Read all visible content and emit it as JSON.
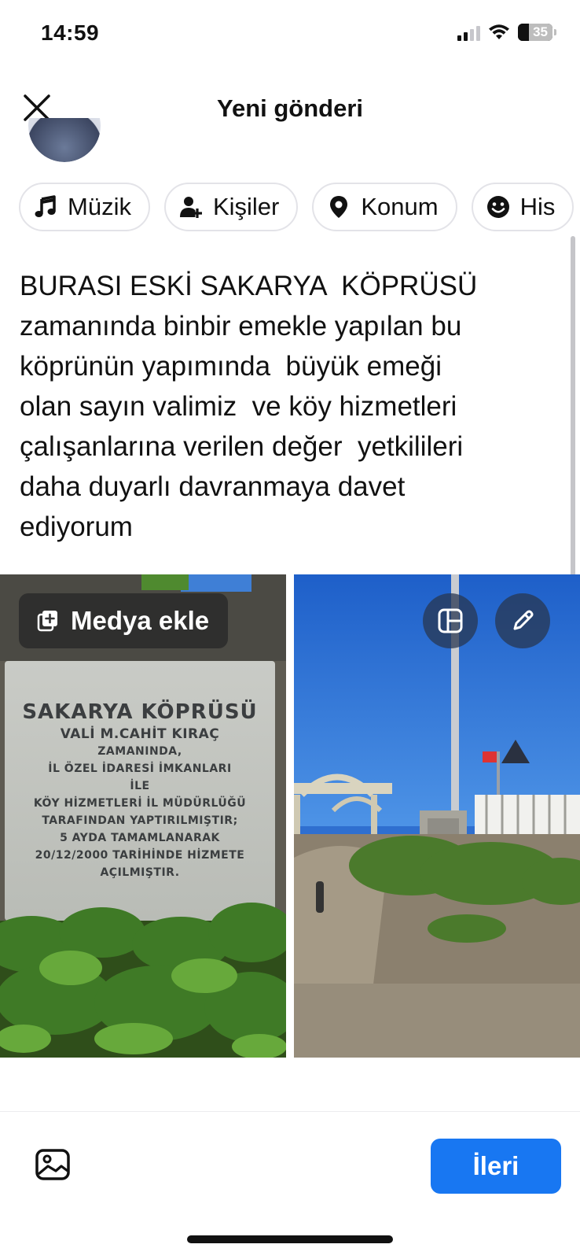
{
  "status_bar": {
    "time": "14:59",
    "battery": "35"
  },
  "header": {
    "title": "Yeni gönderi"
  },
  "chips": [
    {
      "label": "Müzik",
      "icon": "music-icon"
    },
    {
      "label": "Kişiler",
      "icon": "people-icon"
    },
    {
      "label": "Konum",
      "icon": "location-pin-icon"
    },
    {
      "label": "His",
      "icon": "smiley-icon"
    }
  ],
  "post": {
    "text": "BURASI ESKİ SAKARYA  KÖPRÜSÜ\nzamanında binbir emekle yapılan bu\nköprünün yapımında  büyük emeği\nolan sayın valimiz  ve köy hizmetleri\nçalışanlarına verilen değer  yetkilileri\ndaha duyarlı davranmaya davet\nediyorum"
  },
  "media": {
    "add_media_label": "Medya ekle",
    "plaque_lines": [
      "SAKARYA KÖPRÜSÜ",
      "VALİ M.CAHİT KIRAÇ",
      "ZAMANINDA,",
      "İL ÖZEL İDARESİ İMKANLARI",
      "İLE",
      "KÖY HİZMETLERİ İL MÜDÜRLÜĞÜ",
      "TARAFINDAN YAPTIRILMIŞTIR;",
      "5 AYDA TAMAMLANARAK",
      "20/12/2000 TARİHİNDE HİZMETE",
      "AÇILMIŞTIR."
    ]
  },
  "bottom": {
    "next_label": "İleri"
  },
  "colors": {
    "accent": "#1877f2",
    "chip_border": "#e3e3e8"
  }
}
